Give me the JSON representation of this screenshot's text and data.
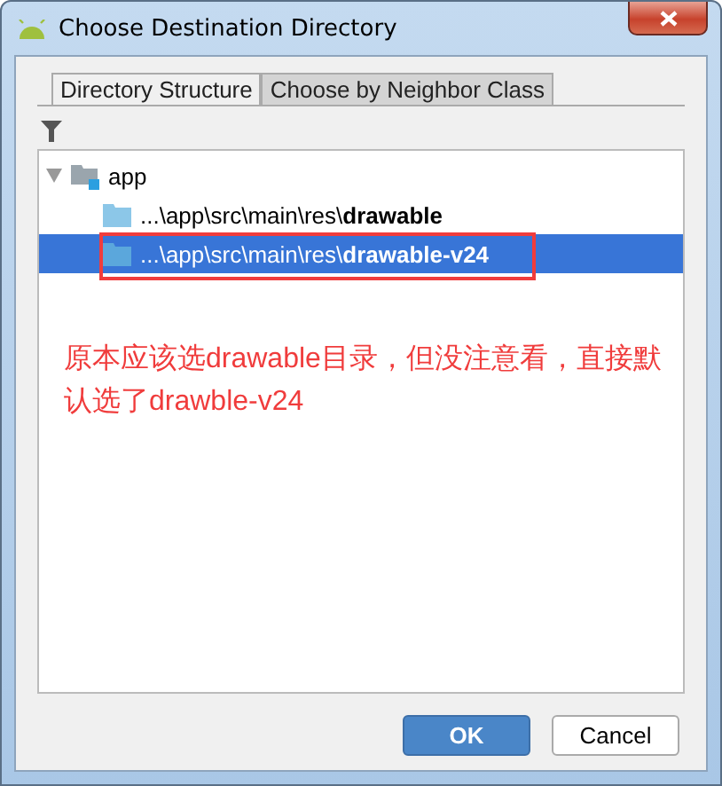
{
  "window": {
    "title": "Choose Destination Directory"
  },
  "tabs": [
    {
      "label": "Directory Structure",
      "selected": true
    },
    {
      "label": "Choose by Neighbor Class",
      "selected": false
    }
  ],
  "tree": [
    {
      "label": "app",
      "expanded": true,
      "selected": false,
      "children": [
        {
          "label": "...\\app\\src\\main\\res\\**drawable**",
          "selected": false
        },
        {
          "label": "...\\app\\src\\main\\res\\**drawable-v24**",
          "selected": true
        }
      ]
    }
  ],
  "annotation": {
    "text": "原本应该选drawable目录，但没注意看，直接默认选了drawble-v24"
  },
  "buttons": [
    {
      "label": "OK",
      "kind": "primary"
    },
    {
      "label": "Cancel",
      "kind": "secondary"
    }
  ]
}
